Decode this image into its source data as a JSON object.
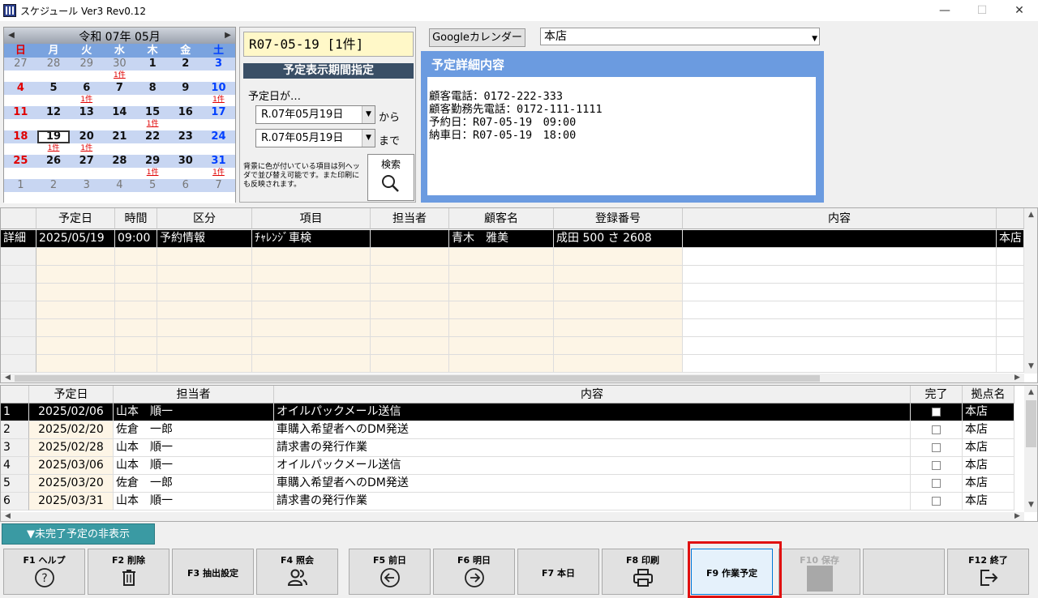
{
  "window": {
    "title": "スケジュール Ver3 Rev0.12",
    "minimize": "—",
    "maximize": "☐",
    "close": "✕"
  },
  "calendar": {
    "prev": "◀",
    "next": "▶",
    "month_label": "令和 07年 05月",
    "weekdays": [
      "日",
      "月",
      "火",
      "水",
      "木",
      "金",
      "土"
    ],
    "weeks": [
      {
        "days": [
          "27",
          "28",
          "29",
          "30",
          "1",
          "2",
          "3"
        ],
        "events": [
          "",
          "",
          "",
          "1件",
          "",
          "",
          ""
        ]
      },
      {
        "days": [
          "4",
          "5",
          "6",
          "7",
          "8",
          "9",
          "10"
        ],
        "events": [
          "",
          "",
          "1件",
          "",
          "",
          "",
          "1件"
        ]
      },
      {
        "days": [
          "11",
          "12",
          "13",
          "14",
          "15",
          "16",
          "17"
        ],
        "events": [
          "",
          "",
          "",
          "",
          "1件",
          "",
          ""
        ]
      },
      {
        "days": [
          "18",
          "19",
          "20",
          "21",
          "22",
          "23",
          "24"
        ],
        "events": [
          "",
          "1件",
          "1件",
          "",
          "",
          "",
          ""
        ]
      },
      {
        "days": [
          "25",
          "26",
          "27",
          "28",
          "29",
          "30",
          "31"
        ],
        "events": [
          "",
          "",
          "",
          "",
          "1件",
          "",
          "1件"
        ]
      },
      {
        "days": [
          "1",
          "2",
          "3",
          "4",
          "5",
          "6",
          "7"
        ],
        "events": [
          "",
          "",
          "",
          "",
          "",
          "",
          ""
        ]
      }
    ]
  },
  "date_panel": {
    "display": "R07-05-19 [1件]",
    "period_header": "予定表示期間指定",
    "period_label": "予定日が…",
    "from_date": "R.07年05月19日",
    "from_suffix": "から",
    "to_date": "R.07年05月19日",
    "to_suffix": "まで",
    "note": "背景に色が付いている項目は列ヘッダで並び替え可能です。また印刷にも反映されます。",
    "search_label": "検索"
  },
  "google_button": "Googleカレンダー",
  "store": "本店",
  "detail": {
    "title": "予定詳細内容",
    "lines": [
      "顧客電話：0172-222-333",
      "顧客勤務先電話：0172-111-1111",
      "予約日：R07-05-19　09:00",
      "納車日：R07-05-19　18:00"
    ]
  },
  "schedule_grid": {
    "headers": [
      "予定日",
      "時間",
      "区分",
      "項目",
      "担当者",
      "顧客名",
      "登録番号",
      "内容"
    ],
    "row": {
      "head": "詳細",
      "cells": [
        "2025/05/19",
        "09:00",
        "予約情報",
        "ﾁｬﾚﾝｼﾞ車検",
        "",
        "青木　雅美",
        "成田 500 さ 2608",
        "",
        "本店"
      ]
    }
  },
  "task_grid": {
    "headers": [
      "予定日",
      "担当者",
      "内容",
      "完了",
      "拠点名"
    ],
    "rows": [
      {
        "no": "1",
        "date": "2025/02/06",
        "person": "山本　順一",
        "content": "オイルパックメール送信",
        "store": "本店"
      },
      {
        "no": "2",
        "date": "2025/02/20",
        "person": "佐倉　一郎",
        "content": "車購入希望者へのDM発送",
        "store": "本店"
      },
      {
        "no": "3",
        "date": "2025/02/28",
        "person": "山本　順一",
        "content": "請求書の発行作業",
        "store": "本店"
      },
      {
        "no": "4",
        "date": "2025/03/06",
        "person": "山本　順一",
        "content": "オイルパックメール送信",
        "store": "本店"
      },
      {
        "no": "5",
        "date": "2025/03/20",
        "person": "佐倉　一郎",
        "content": "車購入希望者へのDM発送",
        "store": "本店"
      },
      {
        "no": "6",
        "date": "2025/03/31",
        "person": "山本　順一",
        "content": "請求書の発行作業",
        "store": "本店"
      }
    ]
  },
  "hide_button": "▼未完了予定の非表示",
  "fkeys": {
    "f1": "F1 ヘルプ",
    "f2": "F2 削除",
    "f3": "F3 抽出設定",
    "f4": "F4 照会",
    "f5": "F5 前日",
    "f6": "F6 明日",
    "f7": "F7 本日",
    "f8": "F8 印刷",
    "f9": "F9 作業予定",
    "f10": "F10 保存",
    "f11": "",
    "f12": "F12 終了"
  }
}
